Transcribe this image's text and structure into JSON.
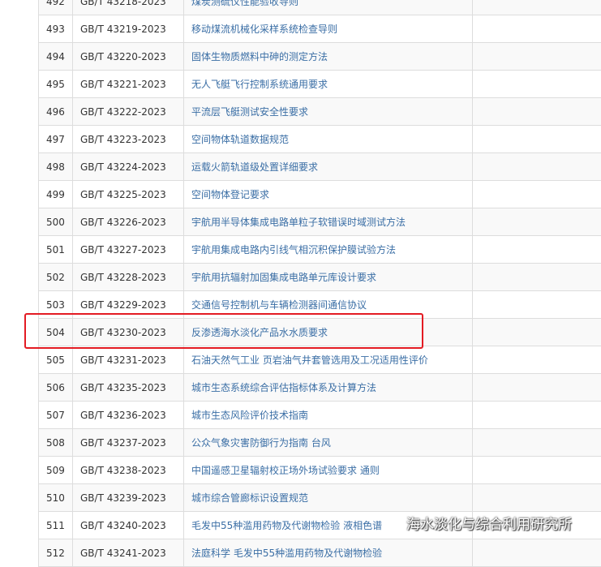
{
  "rows": [
    {
      "num": "492",
      "code": "GB/T 43218-2023",
      "title": "煤炭测硫仪性能验收导则"
    },
    {
      "num": "493",
      "code": "GB/T 43219-2023",
      "title": "移动煤流机械化采样系统检查导则"
    },
    {
      "num": "494",
      "code": "GB/T 43220-2023",
      "title": "固体生物质燃料中砷的测定方法"
    },
    {
      "num": "495",
      "code": "GB/T 43221-2023",
      "title": "无人飞艇飞行控制系统通用要求"
    },
    {
      "num": "496",
      "code": "GB/T 43222-2023",
      "title": "平流层飞艇测试安全性要求"
    },
    {
      "num": "497",
      "code": "GB/T 43223-2023",
      "title": "空间物体轨道数据规范"
    },
    {
      "num": "498",
      "code": "GB/T 43224-2023",
      "title": "运载火箭轨道级处置详细要求"
    },
    {
      "num": "499",
      "code": "GB/T 43225-2023",
      "title": "空间物体登记要求"
    },
    {
      "num": "500",
      "code": "GB/T 43226-2023",
      "title": "宇航用半导体集成电路单粒子软错误时域测试方法"
    },
    {
      "num": "501",
      "code": "GB/T 43227-2023",
      "title": "宇航用集成电路内引线气相沉积保护膜试验方法"
    },
    {
      "num": "502",
      "code": "GB/T 43228-2023",
      "title": "宇航用抗辐射加固集成电路单元库设计要求"
    },
    {
      "num": "503",
      "code": "GB/T 43229-2023",
      "title": "交通信号控制机与车辆检测器间通信协议"
    },
    {
      "num": "504",
      "code": "GB/T 43230-2023",
      "title": "反渗透海水淡化产品水水质要求"
    },
    {
      "num": "505",
      "code": "GB/T 43231-2023",
      "title": "石油天然气工业 页岩油气井套管选用及工况适用性评价"
    },
    {
      "num": "506",
      "code": "GB/T 43235-2023",
      "title": "城市生态系统综合评估指标体系及计算方法"
    },
    {
      "num": "507",
      "code": "GB/T 43236-2023",
      "title": "城市生态风险评价技术指南"
    },
    {
      "num": "508",
      "code": "GB/T 43237-2023",
      "title": "公众气象灾害防御行为指南 台风"
    },
    {
      "num": "509",
      "code": "GB/T 43238-2023",
      "title": "中国遥感卫星辐射校正场外场试验要求 通则"
    },
    {
      "num": "510",
      "code": "GB/T 43239-2023",
      "title": "城市综合管廊标识设置规范"
    },
    {
      "num": "511",
      "code": "GB/T 43240-2023",
      "title": "毛发中55种滥用药物及代谢物检验 液相色谱"
    },
    {
      "num": "512",
      "code": "GB/T 43241-2023",
      "title": "法庭科学 毛发中55种滥用药物及代谢物检验"
    }
  ],
  "watermark": {
    "text": "海水淡化与综合利用研究所",
    "icon": "wechat-icon"
  },
  "colors": {
    "highlight": "#e31b23",
    "link": "#3a6ea5",
    "border": "#dddddd"
  }
}
